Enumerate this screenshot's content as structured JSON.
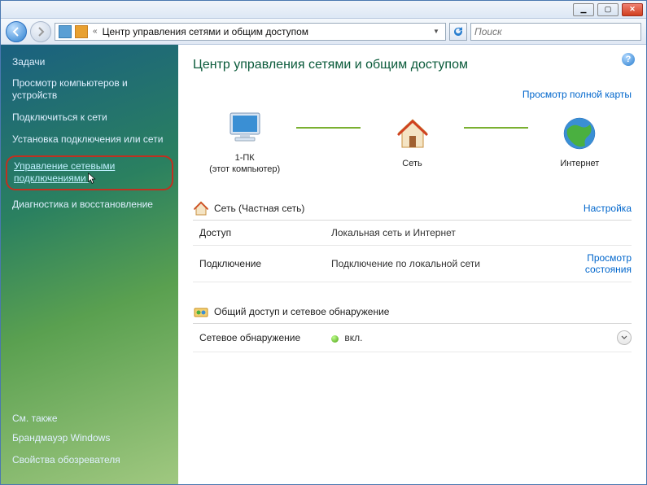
{
  "address": {
    "title": "Центр управления сетями и общим доступом"
  },
  "search": {
    "placeholder": "Поиск"
  },
  "sidebar": {
    "tasks_head": "Задачи",
    "links": [
      "Просмотр компьютеров и устройств",
      "Подключиться к сети",
      "Установка подключения или сети",
      "Управление сетевыми подключениями",
      "Диагностика и восстановление"
    ],
    "see_also_head": "См. также",
    "see_also": [
      "Брандмауэр Windows",
      "Свойства обозревателя"
    ]
  },
  "content": {
    "title": "Центр управления сетями и общим доступом",
    "map_link": "Просмотр полной карты",
    "nodes": {
      "pc": {
        "label": "1-ПК",
        "sub": "(этот компьютер)"
      },
      "net": {
        "label": "Сеть"
      },
      "internet": {
        "label": "Интернет"
      }
    },
    "network_section": {
      "header": "Сеть (Частная сеть)",
      "customize": "Настройка",
      "rows": [
        {
          "k": "Доступ",
          "v": "Локальная сеть и Интернет",
          "action": ""
        },
        {
          "k": "Подключение",
          "v": "Подключение по локальной сети",
          "action": "Просмотр\nсостояния"
        }
      ]
    },
    "sharing_section": {
      "header": "Общий доступ и сетевое обнаружение",
      "row": {
        "k": "Сетевое обнаружение",
        "v": "вкл."
      }
    }
  }
}
